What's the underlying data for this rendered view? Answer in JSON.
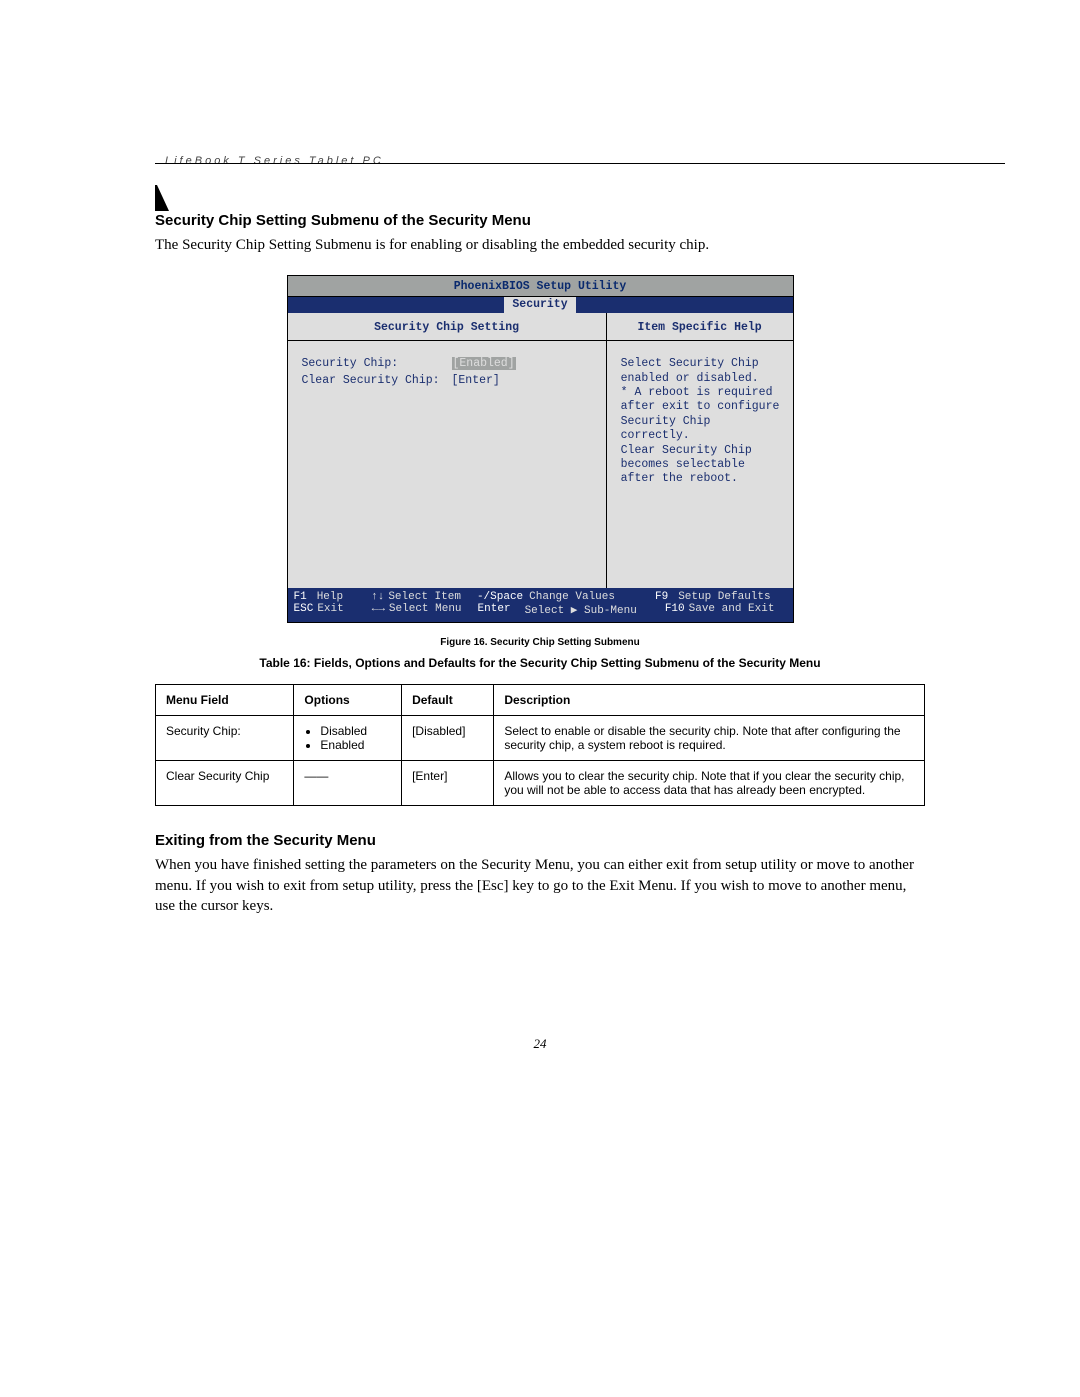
{
  "running_head": "LifeBook T Series Tablet PC",
  "heading1": "Security Chip Setting Submenu of the Security Menu",
  "intro": "The Security Chip Setting Submenu is for enabling or disabling the embedded security chip.",
  "bios": {
    "title": "PhoenixBIOS Setup Utility",
    "tab": "Security",
    "left_head": "Security Chip Setting",
    "right_head": "Item Specific Help",
    "settings": [
      {
        "label": "Security Chip:",
        "value": "[Enabled]",
        "highlight": true
      },
      {
        "label": "Clear Security Chip:",
        "value": "[Enter]",
        "highlight": false
      }
    ],
    "help_lines": [
      "Select Security Chip",
      "enabled or disabled.",
      "",
      "* A reboot is required",
      "after exit to configure",
      "Security Chip correctly.",
      "Clear Security Chip",
      "becomes selectable",
      "after the reboot."
    ],
    "footer": {
      "f1": "F1",
      "help": "Help",
      "si": "Select Item",
      "cv_key": "-/Space",
      "cv": "Change Values",
      "f9": "F9",
      "sd": "Setup Defaults",
      "esc": "ESC",
      "exit": "Exit",
      "sm": "Select Menu",
      "enter": "Enter",
      "ssm": "Select ▶ Sub-Menu",
      "f10": "F10",
      "se": "Save and Exit"
    }
  },
  "figure_caption": "Figure 16.  Security Chip Setting Submenu",
  "table_caption": "Table 16: Fields, Options and Defaults for the Security Chip Setting Submenu of the Security Menu",
  "table": {
    "headers": [
      "Menu Field",
      "Options",
      "Default",
      "Description"
    ],
    "rows": [
      {
        "field": "Security Chip:",
        "options": [
          "Disabled",
          "Enabled"
        ],
        "default": "[Disabled]",
        "desc": "Select to enable or disable the security chip. Note that after configuring the security chip, a system reboot is required."
      },
      {
        "field": "Clear Security Chip",
        "options": [],
        "default": "[Enter]",
        "desc": "Allows you to clear the security chip. Note that if you clear the security chip, you will not be able to access data that has already been encrypted."
      }
    ]
  },
  "heading2": "Exiting from the Security Menu",
  "exit_text": "When you have finished setting the parameters on the Security Menu, you can either exit from setup utility or move to another menu. If you wish to exit from setup utility, press the [Esc] key to go to the Exit Menu. If you wish to move to another menu, use the cursor keys.",
  "page_number": "24"
}
